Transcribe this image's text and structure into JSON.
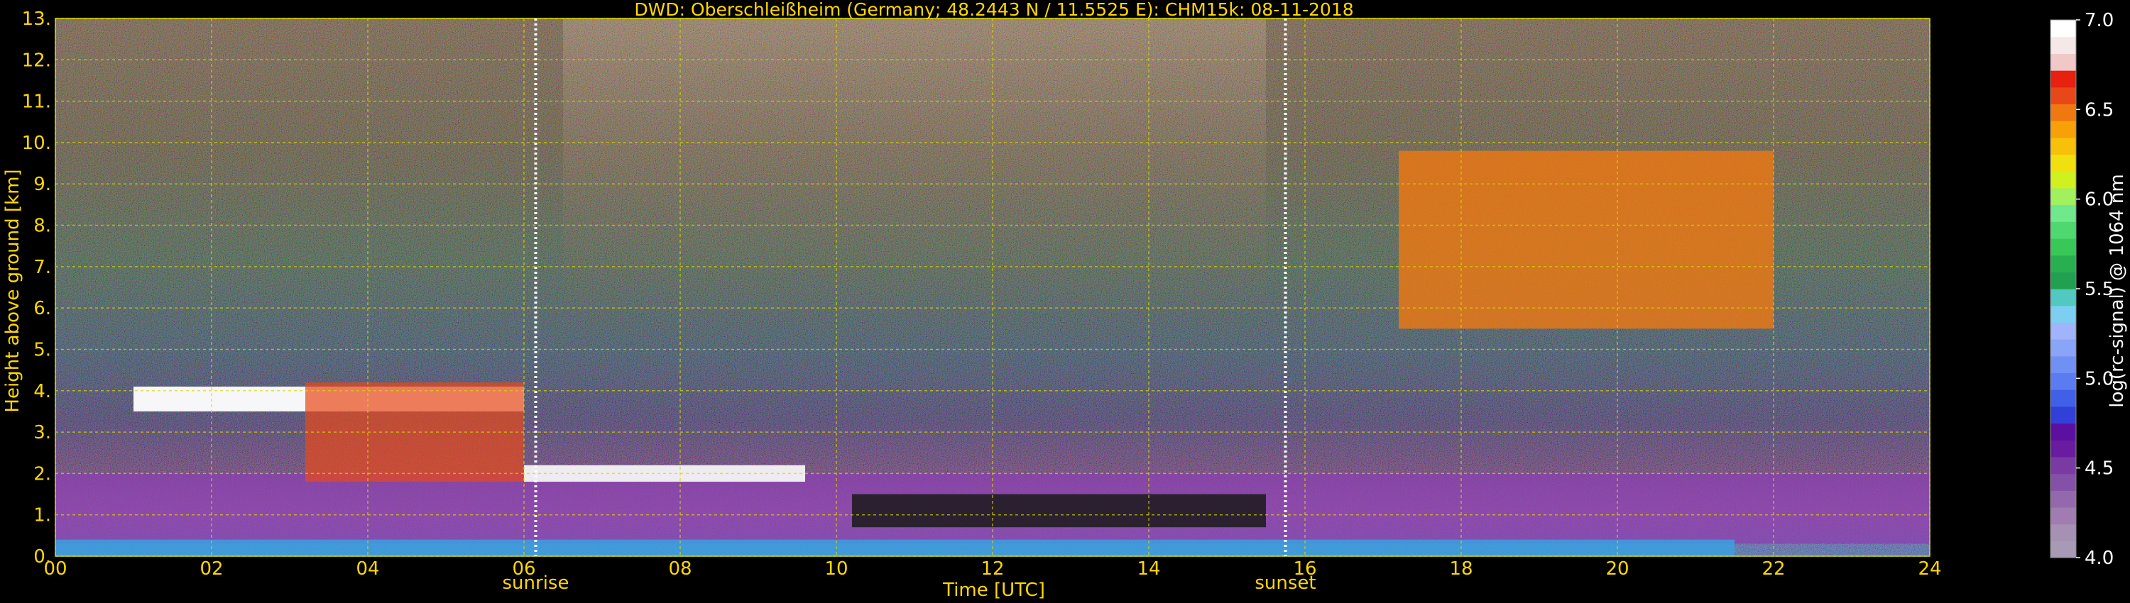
{
  "chart_data": {
    "type": "heatmap",
    "title": "DWD: Oberschleißheim (Germany; 48.2443 N / 11.5525 E):    CHM15k: 08-11-2018",
    "xlabel": "Time [UTC]",
    "ylabel": "Height above ground [km]",
    "xlim": [
      0,
      24
    ],
    "ylim": [
      0,
      13
    ],
    "x_ticks": [
      "00",
      "02",
      "04",
      "06",
      "08",
      "10",
      "12",
      "14",
      "16",
      "18",
      "20",
      "22",
      "24"
    ],
    "y_ticks": [
      "0.",
      "1.",
      "2.",
      "3.",
      "4.",
      "5.",
      "6.",
      "7.",
      "8.",
      "9.",
      "10.",
      "11.",
      "12.",
      "13."
    ],
    "grid": true,
    "markers": [
      {
        "label": "sunrise",
        "x": 6.15
      },
      {
        "label": "sunset",
        "x": 15.75
      }
    ],
    "colorbar": {
      "label": "log(rc-signal) @ 1064 nm",
      "range": [
        4.0,
        7.0
      ],
      "ticks": [
        "4.0",
        "4.5",
        "5.0",
        "5.5",
        "6.0",
        "6.5",
        "7.0"
      ],
      "colors": [
        "#a89ab4",
        "#a690b4",
        "#a07cb0",
        "#9468ac",
        "#8450a8",
        "#7a3aa4",
        "#6a1ca0",
        "#5c10a0",
        "#3040d8",
        "#4060e8",
        "#5a7cf0",
        "#7090f4",
        "#8aa4f8",
        "#a0b4fc",
        "#7ccff0",
        "#52c8c0",
        "#20a050",
        "#28b050",
        "#38c858",
        "#50d870",
        "#70e88c",
        "#a0f060",
        "#d0f020",
        "#f0e010",
        "#f8c008",
        "#f8a008",
        "#f07810",
        "#e84818",
        "#e82010",
        "#f0c8c8",
        "#f4e8e8",
        "#ffffff"
      ]
    },
    "layers": [
      {
        "feature": "aerosol boundary layer (magenta/violet)",
        "x": [
          0,
          24
        ],
        "y_km": [
          0.3,
          2.0
        ]
      },
      {
        "feature": "near-surface layer (blue/cyan)",
        "x": [
          0,
          21.5
        ],
        "y_km": [
          0.0,
          0.4
        ]
      },
      {
        "feature": "cloud layer (white)",
        "x": [
          1.0,
          6.0
        ],
        "y_km": [
          3.5,
          4.1
        ]
      },
      {
        "feature": "cloud with virga (red/green)",
        "x": [
          3.2,
          6.0
        ],
        "y_km": [
          1.8,
          4.2
        ]
      },
      {
        "feature": "stratocumulus (white)",
        "x": [
          6.0,
          9.6
        ],
        "y_km": [
          1.8,
          2.2
        ]
      },
      {
        "feature": "low cloud (black/white)",
        "x": [
          10.2,
          15.5
        ],
        "y_km": [
          0.7,
          1.5
        ]
      },
      {
        "feature": "cirrus (orange/red)",
        "x": [
          17.2,
          22.0
        ],
        "y_km": [
          5.5,
          9.8
        ]
      }
    ]
  }
}
